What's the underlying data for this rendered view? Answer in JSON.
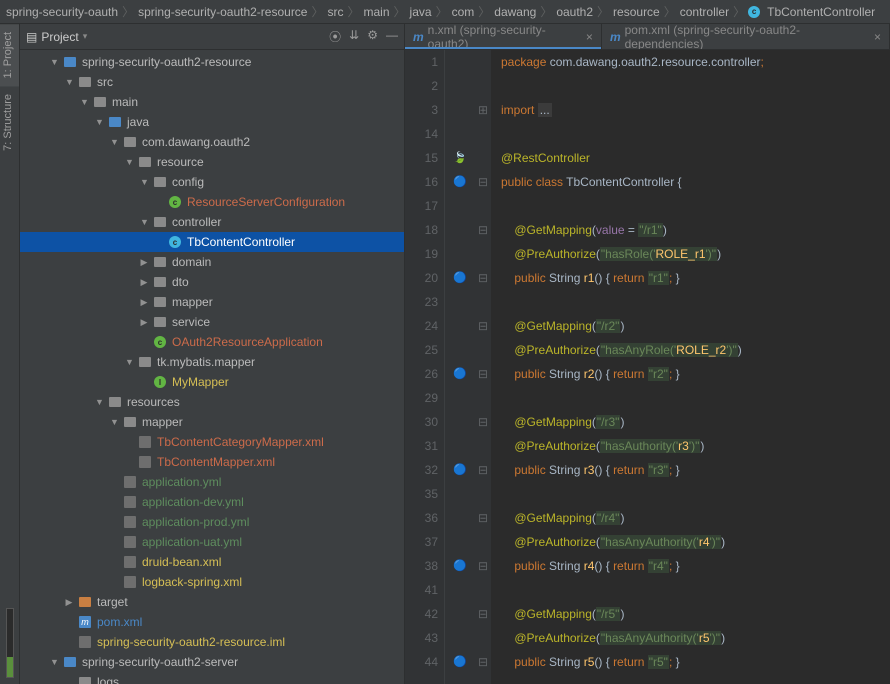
{
  "breadcrumb": [
    "spring-security-oauth",
    "spring-security-oauth2-resource",
    "src",
    "main",
    "java",
    "com",
    "dawang",
    "oauth2",
    "resource",
    "controller",
    "TbContentController"
  ],
  "sidebarTabs": {
    "project": "1: Project",
    "structure": "7: Structure"
  },
  "projHeader": {
    "title": "Project"
  },
  "tree": [
    {
      "d": 2,
      "a": "▼",
      "i": "folder",
      "c": "blue",
      "t": "spring-security-oauth2-resource",
      "bold": true
    },
    {
      "d": 3,
      "a": "▼",
      "i": "folder",
      "c": "",
      "t": "src"
    },
    {
      "d": 4,
      "a": "▼",
      "i": "folder",
      "c": "",
      "t": "main"
    },
    {
      "d": 5,
      "a": "▼",
      "i": "folder",
      "c": "blue",
      "t": "java"
    },
    {
      "d": 6,
      "a": "▼",
      "i": "folder",
      "c": "",
      "t": "com.dawang.oauth2"
    },
    {
      "d": 7,
      "a": "▼",
      "i": "folder",
      "c": "",
      "t": "resource"
    },
    {
      "d": 8,
      "a": "▼",
      "i": "folder",
      "c": "",
      "t": "config"
    },
    {
      "d": 9,
      "a": "",
      "i": "circle",
      "c": "g",
      "ch": "c",
      "t": "ResourceServerConfiguration",
      "col": "#cc6b4a"
    },
    {
      "d": 8,
      "a": "▼",
      "i": "folder",
      "c": "",
      "t": "controller"
    },
    {
      "d": 9,
      "a": "",
      "i": "circle",
      "c": "b",
      "ch": "c",
      "t": "TbContentController",
      "sel": true
    },
    {
      "d": 8,
      "a": "▶",
      "i": "folder",
      "c": "",
      "t": "domain"
    },
    {
      "d": 8,
      "a": "▶",
      "i": "folder",
      "c": "",
      "t": "dto"
    },
    {
      "d": 8,
      "a": "▶",
      "i": "folder",
      "c": "",
      "t": "mapper"
    },
    {
      "d": 8,
      "a": "▶",
      "i": "folder",
      "c": "",
      "t": "service"
    },
    {
      "d": 8,
      "a": "",
      "i": "circle",
      "c": "g",
      "ch": "c",
      "t": "OAuth2ResourceApplication",
      "col": "#cc6b4a"
    },
    {
      "d": 7,
      "a": "▼",
      "i": "folder",
      "c": "",
      "t": "tk.mybatis.mapper"
    },
    {
      "d": 8,
      "a": "",
      "i": "circle",
      "c": "g",
      "ch": "I",
      "t": "MyMapper",
      "col": "#d6bf55"
    },
    {
      "d": 5,
      "a": "▼",
      "i": "folder",
      "c": "",
      "t": "resources"
    },
    {
      "d": 6,
      "a": "▼",
      "i": "folder",
      "c": "",
      "t": "mapper"
    },
    {
      "d": 7,
      "a": "",
      "i": "file",
      "c": "",
      "t": "TbContentCategoryMapper.xml",
      "col": "#cc6b4a"
    },
    {
      "d": 7,
      "a": "",
      "i": "file",
      "c": "",
      "t": "TbContentMapper.xml",
      "col": "#cc6b4a"
    },
    {
      "d": 6,
      "a": "",
      "i": "file",
      "c": "",
      "t": "application.yml",
      "col": "#5e8d5e"
    },
    {
      "d": 6,
      "a": "",
      "i": "file",
      "c": "",
      "t": "application-dev.yml",
      "col": "#5e8d5e"
    },
    {
      "d": 6,
      "a": "",
      "i": "file",
      "c": "",
      "t": "application-prod.yml",
      "col": "#5e8d5e"
    },
    {
      "d": 6,
      "a": "",
      "i": "file",
      "c": "",
      "t": "application-uat.yml",
      "col": "#5e8d5e"
    },
    {
      "d": 6,
      "a": "",
      "i": "file",
      "c": "",
      "t": "druid-bean.xml",
      "col": "#d6bf55"
    },
    {
      "d": 6,
      "a": "",
      "i": "file",
      "c": "",
      "t": "logback-spring.xml",
      "col": "#d6bf55"
    },
    {
      "d": 3,
      "a": "▶",
      "i": "folder",
      "c": "orange",
      "t": "target"
    },
    {
      "d": 3,
      "a": "",
      "i": "file",
      "c": "",
      "t": "pom.xml",
      "col": "#4a88c7",
      "pre": "m"
    },
    {
      "d": 3,
      "a": "",
      "i": "file",
      "c": "",
      "t": "spring-security-oauth2-resource.iml",
      "col": "#d6bf55"
    },
    {
      "d": 2,
      "a": "▼",
      "i": "folder",
      "c": "blue",
      "t": "spring-security-oauth2-server",
      "bold": true
    },
    {
      "d": 3,
      "a": "",
      "i": "folder",
      "c": "",
      "t": "logs"
    }
  ],
  "editorTabs": [
    {
      "label": "n.xml (spring-security-oauth2)",
      "icon": "m",
      "ul": true
    },
    {
      "label": "pom.xml (spring-security-oauth2-dependencies)",
      "icon": "m",
      "ul": false
    }
  ],
  "code": {
    "lines": [
      {
        "n": 1,
        "html": "<span class='kw'>package </span><span>com.dawang.oauth2.resource.controller</span><span class='kw'>;</span>"
      },
      {
        "n": 2,
        "html": ""
      },
      {
        "n": 3,
        "fold": "⊞",
        "html": "<span class='kw'>import </span><span style='background:#3b3b3b;padding:0 2px'>...</span>"
      },
      {
        "n": 14,
        "html": ""
      },
      {
        "n": 15,
        "mark": "🍃",
        "fold": "",
        "html": "<span class='ann'>@RestController</span>"
      },
      {
        "n": 16,
        "mark": "🔵",
        "fold": "⊟",
        "html": "<span class='kw'>public class </span><span class='cls'>TbContentController </span>{"
      },
      {
        "n": 17,
        "html": ""
      },
      {
        "n": 18,
        "fold": "⊟",
        "html": "    <span class='ann'>@GetMapping</span>(<span style='color:#9876aa'>value</span> = <span class='str bg-str'>\"/r1\"</span>)"
      },
      {
        "n": 19,
        "html": "    <span class='ann'>@PreAuthorize</span>(<span class='str bg-str'>\"hasRole('<span style='color:#ffc66d'>ROLE_r1</span>')\"</span>)"
      },
      {
        "n": 20,
        "mark": "🔵",
        "fold": "⊟",
        "html": "    <span class='kw'>public </span>String <span class='name'>r1</span>() { <span class='kw'>return </span><span class='str bg-str'>\"r1\"</span><span class='kw'>;</span> }"
      },
      {
        "n": 23,
        "html": ""
      },
      {
        "n": 24,
        "fold": "⊟",
        "html": "    <span class='ann'>@GetMapping</span>(<span class='str bg-str'>\"/r2\"</span>)"
      },
      {
        "n": 25,
        "html": "    <span class='ann'>@PreAuthorize</span>(<span class='str bg-str'>\"hasAnyRole('<span style='color:#ffc66d'>ROLE_r2</span>')\"</span>)"
      },
      {
        "n": 26,
        "mark": "🔵",
        "fold": "⊟",
        "html": "    <span class='kw'>public </span>String <span class='name'>r2</span>() { <span class='kw'>return </span><span class='str bg-str'>\"r2\"</span><span class='kw'>;</span> }"
      },
      {
        "n": 29,
        "html": ""
      },
      {
        "n": 30,
        "fold": "⊟",
        "html": "    <span class='ann'>@GetMapping</span>(<span class='str bg-str'>\"/r3\"</span>)"
      },
      {
        "n": 31,
        "html": "    <span class='ann'>@PreAuthorize</span>(<span class='str bg-str'>\"hasAuthority('<span style='color:#ffc66d'>r3</span>')\"</span>)"
      },
      {
        "n": 32,
        "mark": "🔵",
        "fold": "⊟",
        "html": "    <span class='kw'>public </span>String <span class='name'>r3</span>() { <span class='kw'>return </span><span class='str bg-str'>\"r3\"</span><span class='kw'>;</span> }"
      },
      {
        "n": 35,
        "html": ""
      },
      {
        "n": 36,
        "fold": "⊟",
        "html": "    <span class='ann'>@GetMapping</span>(<span class='str bg-str'>\"/r4\"</span>)"
      },
      {
        "n": 37,
        "html": "    <span class='ann'>@PreAuthorize</span>(<span class='str bg-str'>\"hasAnyAuthority('<span style='color:#ffc66d'>r4</span>')\"</span>)"
      },
      {
        "n": 38,
        "mark": "🔵",
        "fold": "⊟",
        "html": "    <span class='kw'>public </span>String <span class='name'>r4</span>() { <span class='kw'>return </span><span class='str bg-str'>\"r4\"</span><span class='kw'>;</span> }"
      },
      {
        "n": 41,
        "html": ""
      },
      {
        "n": 42,
        "fold": "⊟",
        "html": "    <span class='ann'>@GetMapping</span>(<span class='str bg-str'>\"/r5\"</span>)"
      },
      {
        "n": 43,
        "html": "    <span class='ann'>@PreAuthorize</span>(<span class='str bg-str'>\"hasAnyAuthority('<span style='color:#ffc66d'>r5</span>')\"</span>)"
      },
      {
        "n": 44,
        "mark": "🔵",
        "fold": "⊟",
        "html": "    <span class='kw'>public </span>String <span class='name'>r5</span>() { <span class='kw'>return </span><span class='str bg-str'>\"r5\"</span><span class='kw'>;</span> }"
      }
    ]
  }
}
